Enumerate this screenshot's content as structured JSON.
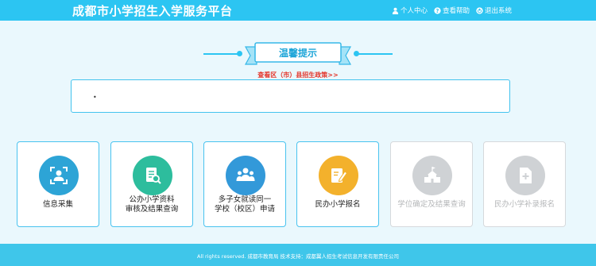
{
  "header": {
    "title": "成都市小学招生入学服务平台",
    "nav": {
      "personal_center": "个人中心",
      "help": "查看帮助",
      "logout": "退出系统"
    }
  },
  "banner": {
    "title": "温馨提示"
  },
  "policy_link": "查看区（市）县招生政策>>",
  "notice": {
    "text": "•"
  },
  "cards": [
    {
      "label": "信息采集",
      "icon": "id-scan-icon",
      "color": "#2da4d6",
      "enabled": true
    },
    {
      "label": "公办小学资料\n审核及结果查询",
      "icon": "document-search-icon",
      "color": "#2dbd9d",
      "enabled": true
    },
    {
      "label": "多子女就读同一\n学校（校区）申请",
      "icon": "people-group-icon",
      "color": "#3399d9",
      "enabled": true
    },
    {
      "label": "民办小学报名",
      "icon": "edit-form-icon",
      "color": "#f3b12c",
      "enabled": true
    },
    {
      "label": "学位确定及结果查询",
      "icon": "school-building-icon",
      "color": "#cfd2d5",
      "enabled": false
    },
    {
      "label": "民办小学补录报名",
      "icon": "add-document-icon",
      "color": "#cfd2d5",
      "enabled": false
    }
  ],
  "footer": {
    "text": "All rights reserved. 成都市教育局    技术支持：成都翼人招生考试信息开发有限责任公司"
  }
}
